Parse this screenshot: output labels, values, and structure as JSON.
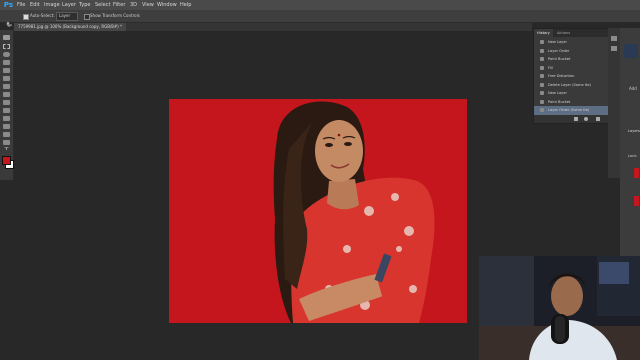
{
  "menubar": {
    "logo": "Ps",
    "items": [
      "File",
      "Edit",
      "Image",
      "Layer",
      "Type",
      "Select",
      "Filter",
      "3D",
      "View",
      "Window",
      "Help"
    ]
  },
  "options": {
    "auto_select_label": "Auto-Select:",
    "auto_select_value": "Layer",
    "show_transform_label": "Show Transform Controls"
  },
  "document": {
    "tab_title": "7759981.jpg @ 100% (Background copy, RGB/8#) *"
  },
  "history": {
    "tabs": [
      "History",
      "Actions"
    ],
    "items": [
      "New Layer",
      "Layer Order",
      "Paint Bucket",
      "Fill",
      "Free Distortion",
      "Delete Layer (Some Ite)",
      "New Layer",
      "Paint Bucket",
      "Layer Order (Some Ite)"
    ],
    "selected_index": 8
  },
  "right_panel": {
    "labels": [
      "Add",
      "Layers",
      "Lock:",
      "Fill"
    ]
  },
  "colors": {
    "foreground": "#c4161c",
    "background": "#ffffff",
    "photo_background": "#c4161c"
  }
}
